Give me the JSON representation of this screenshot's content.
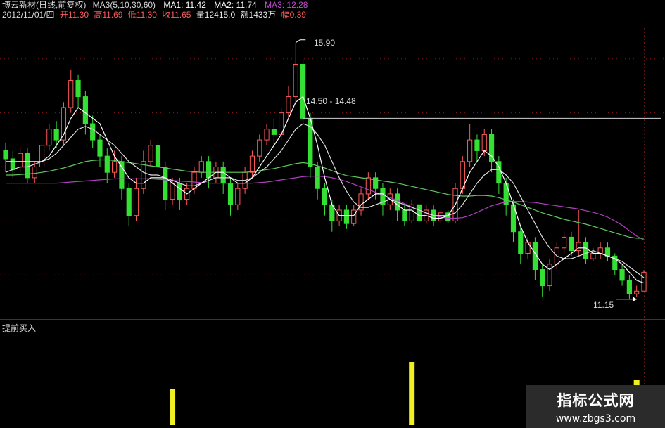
{
  "header": {
    "stock_name": "博云新材(日线,前复权)",
    "ma3_label": "MA3(5,10,30,60)",
    "ma1": "MA1: 11.42",
    "ma2": "MA2: 11.74",
    "ma3": "MA3: 12.28",
    "date": "2012/11/01/四",
    "open": "开11.30",
    "high": "高11.69",
    "low": "低11.30",
    "close": "收11.65",
    "volume": "量12415.0",
    "amount": "额1433万",
    "change": "幅0.39"
  },
  "annotations": {
    "high_price": "15.90",
    "range": "14.50 - 14.48",
    "low_price": "11.15"
  },
  "indicator": {
    "title": "提前买入"
  },
  "watermark": {
    "line1": "指标公式网",
    "line2": "www.zbgs3.com"
  },
  "colors": {
    "up": "#ff5a5a",
    "down": "#33e033",
    "ma_white": "#ffffff",
    "ma_green": "#5ec85e",
    "ma_purple": "#b040c0",
    "signal": "#f0f020",
    "divider": "#b02020"
  },
  "chart_data": [
    {
      "type": "candlestick",
      "title": "博云新材(日线,前复权)",
      "ylim": [
        10.9,
        16.3
      ],
      "annotations": {
        "high": 15.9,
        "range": [
          14.5,
          14.48
        ],
        "low": 11.15
      },
      "ohlc": [
        [
          13.9,
          13.75,
          14.05,
          13.5
        ],
        [
          13.75,
          13.55,
          13.9,
          13.4
        ],
        [
          13.6,
          13.85,
          13.95,
          13.5
        ],
        [
          13.85,
          13.4,
          13.95,
          13.3
        ],
        [
          13.4,
          13.6,
          13.7,
          13.3
        ],
        [
          13.6,
          14.0,
          14.1,
          13.55
        ],
        [
          14.0,
          14.3,
          14.4,
          13.9
        ],
        [
          14.3,
          14.1,
          14.45,
          13.95
        ],
        [
          14.1,
          14.7,
          14.8,
          14.0
        ],
        [
          14.7,
          15.2,
          15.4,
          14.6
        ],
        [
          15.2,
          14.9,
          15.3,
          14.7
        ],
        [
          14.9,
          14.4,
          15.0,
          14.2
        ],
        [
          14.4,
          14.1,
          14.55,
          13.95
        ],
        [
          14.1,
          13.8,
          14.2,
          13.6
        ],
        [
          13.8,
          13.5,
          13.95,
          13.3
        ],
        [
          13.5,
          13.7,
          13.9,
          13.4
        ],
        [
          13.7,
          13.2,
          13.8,
          13.0
        ],
        [
          13.2,
          12.7,
          13.3,
          12.5
        ],
        [
          12.7,
          13.2,
          13.4,
          12.6
        ],
        [
          13.2,
          13.7,
          13.9,
          13.1
        ],
        [
          13.7,
          14.0,
          14.1,
          13.6
        ],
        [
          14.0,
          13.6,
          14.1,
          13.4
        ],
        [
          13.6,
          13.0,
          13.7,
          12.8
        ],
        [
          13.0,
          13.3,
          13.4,
          12.9
        ],
        [
          13.3,
          13.0,
          13.4,
          12.8
        ],
        [
          13.0,
          13.2,
          13.3,
          12.9
        ],
        [
          13.2,
          13.5,
          13.6,
          13.1
        ],
        [
          13.5,
          13.7,
          13.8,
          13.4
        ],
        [
          13.7,
          13.4,
          13.8,
          13.2
        ],
        [
          13.4,
          13.6,
          13.7,
          13.3
        ],
        [
          13.6,
          13.3,
          13.7,
          13.1
        ],
        [
          13.3,
          12.9,
          13.4,
          12.7
        ],
        [
          12.9,
          13.2,
          13.3,
          12.8
        ],
        [
          13.2,
          13.5,
          13.6,
          13.1
        ],
        [
          13.5,
          13.8,
          13.9,
          13.4
        ],
        [
          13.8,
          14.1,
          14.2,
          13.7
        ],
        [
          14.1,
          14.3,
          14.4,
          14.0
        ],
        [
          14.3,
          14.2,
          14.5,
          14.0
        ],
        [
          14.2,
          14.6,
          14.7,
          14.1
        ],
        [
          14.6,
          14.9,
          15.1,
          14.5
        ],
        [
          14.9,
          15.5,
          15.9,
          14.8
        ],
        [
          15.5,
          14.5,
          15.6,
          14.4
        ],
        [
          14.5,
          13.6,
          14.6,
          13.4
        ],
        [
          13.6,
          13.2,
          13.7,
          13.0
        ],
        [
          13.2,
          12.9,
          13.3,
          12.7
        ],
        [
          12.9,
          12.6,
          13.0,
          12.4
        ],
        [
          12.6,
          12.8,
          12.9,
          12.5
        ],
        [
          12.8,
          12.55,
          12.9,
          12.45
        ],
        [
          12.55,
          12.8,
          12.9,
          12.5
        ],
        [
          12.8,
          13.1,
          13.2,
          12.7
        ],
        [
          13.1,
          13.4,
          13.5,
          13.0
        ],
        [
          13.4,
          13.2,
          13.5,
          13.0
        ],
        [
          13.2,
          12.9,
          13.3,
          12.7
        ],
        [
          12.9,
          13.1,
          13.2,
          12.8
        ],
        [
          13.1,
          12.8,
          13.2,
          12.6
        ],
        [
          12.8,
          12.6,
          12.9,
          12.5
        ],
        [
          12.6,
          12.9,
          13.0,
          12.55
        ],
        [
          12.9,
          12.6,
          13.0,
          12.5
        ],
        [
          12.6,
          12.8,
          12.9,
          12.55
        ],
        [
          12.8,
          12.6,
          12.9,
          12.5
        ],
        [
          12.6,
          12.75,
          12.8,
          12.55
        ],
        [
          12.75,
          12.6,
          12.8,
          12.55
        ],
        [
          12.6,
          13.2,
          13.3,
          12.55
        ],
        [
          13.2,
          13.7,
          13.8,
          13.1
        ],
        [
          13.7,
          14.1,
          14.4,
          13.6
        ],
        [
          14.1,
          13.9,
          14.2,
          13.7
        ],
        [
          13.9,
          14.2,
          14.3,
          13.8
        ],
        [
          14.2,
          13.7,
          14.3,
          13.5
        ],
        [
          13.7,
          13.3,
          13.8,
          13.1
        ],
        [
          13.3,
          12.9,
          13.4,
          12.7
        ],
        [
          12.9,
          12.4,
          13.0,
          12.2
        ],
        [
          12.4,
          12.0,
          12.5,
          11.8
        ],
        [
          12.0,
          12.2,
          12.3,
          11.9
        ],
        [
          12.2,
          11.7,
          12.3,
          11.5
        ],
        [
          11.7,
          11.4,
          11.8,
          11.2
        ],
        [
          11.4,
          11.8,
          11.9,
          11.3
        ],
        [
          11.8,
          12.1,
          12.2,
          11.7
        ],
        [
          12.1,
          12.3,
          12.4,
          12.0
        ],
        [
          12.3,
          12.05,
          12.4,
          11.95
        ],
        [
          12.05,
          12.2,
          12.8,
          11.95
        ],
        [
          12.2,
          11.9,
          12.3,
          11.8
        ],
        [
          11.9,
          12.0,
          12.1,
          11.85
        ],
        [
          12.0,
          12.1,
          12.2,
          11.9
        ],
        [
          12.1,
          11.95,
          12.2,
          11.85
        ],
        [
          11.95,
          11.7,
          12.0,
          11.6
        ],
        [
          11.7,
          11.5,
          11.8,
          11.4
        ],
        [
          11.5,
          11.25,
          11.6,
          11.15
        ],
        [
          11.25,
          11.3,
          11.4,
          11.2
        ],
        [
          11.3,
          11.65,
          11.69,
          11.3
        ]
      ],
      "ma_white": [
        13.7,
        13.7,
        13.7,
        13.7,
        13.7,
        13.7,
        13.8,
        14.0,
        14.2,
        14.5,
        14.7,
        14.6,
        14.5,
        14.4,
        14.1,
        13.8,
        13.6,
        13.4,
        13.3,
        13.3,
        13.4,
        13.4,
        13.4,
        13.3,
        13.2,
        13.1,
        13.2,
        13.3,
        13.4,
        13.5,
        13.5,
        13.4,
        13.3,
        13.3,
        13.4,
        13.6,
        13.8,
        14.0,
        14.2,
        14.5,
        14.8,
        14.9,
        14.5,
        14.0,
        13.4,
        12.9,
        12.7,
        12.7,
        12.7,
        12.9,
        13.0,
        13.1,
        13.1,
        13.0,
        12.9,
        12.8,
        12.8,
        12.7,
        12.7,
        12.65,
        12.65,
        12.7,
        12.9,
        13.2,
        13.5,
        13.7,
        13.9,
        13.8,
        13.6,
        13.3,
        12.9,
        12.5,
        12.2,
        12.0,
        11.8,
        11.7,
        11.8,
        11.9,
        12.0,
        12.1,
        12.1,
        12.0,
        12.0,
        11.95,
        11.9,
        11.8,
        11.65,
        11.5,
        11.45
      ],
      "ma_white2": [
        13.5,
        13.55,
        13.6,
        13.6,
        13.65,
        13.7,
        13.75,
        13.85,
        14.0,
        14.15,
        14.3,
        14.35,
        14.3,
        14.2,
        14.1,
        14.0,
        13.85,
        13.7,
        13.6,
        13.5,
        13.45,
        13.45,
        13.4,
        13.35,
        13.3,
        13.25,
        13.25,
        13.3,
        13.35,
        13.4,
        13.4,
        13.4,
        13.35,
        13.35,
        13.4,
        13.5,
        13.6,
        13.75,
        13.9,
        14.1,
        14.3,
        14.4,
        14.35,
        14.2,
        14.0,
        13.7,
        13.4,
        13.15,
        12.95,
        12.85,
        12.85,
        12.9,
        12.95,
        13.0,
        12.95,
        12.9,
        12.85,
        12.8,
        12.75,
        12.7,
        12.7,
        12.7,
        12.75,
        12.9,
        13.1,
        13.3,
        13.45,
        13.55,
        13.55,
        13.45,
        13.3,
        13.05,
        12.8,
        12.55,
        12.3,
        12.1,
        11.95,
        11.9,
        11.9,
        11.95,
        12.0,
        12.05,
        12.0,
        11.95,
        11.9,
        11.85,
        11.75,
        11.65,
        11.55
      ],
      "ma_green": [
        13.45,
        13.45,
        13.46,
        13.47,
        13.48,
        13.5,
        13.52,
        13.55,
        13.58,
        13.62,
        13.66,
        13.7,
        13.72,
        13.73,
        13.73,
        13.72,
        13.7,
        13.68,
        13.66,
        13.64,
        13.62,
        13.6,
        13.58,
        13.56,
        13.54,
        13.52,
        13.51,
        13.5,
        13.5,
        13.5,
        13.5,
        13.5,
        13.5,
        13.5,
        13.51,
        13.53,
        13.55,
        13.57,
        13.6,
        13.63,
        13.66,
        13.68,
        13.66,
        13.62,
        13.58,
        13.53,
        13.48,
        13.44,
        13.42,
        13.4,
        13.38,
        13.36,
        13.34,
        13.32,
        13.3,
        13.27,
        13.24,
        13.21,
        13.18,
        13.15,
        13.12,
        13.09,
        13.07,
        13.06,
        13.06,
        13.07,
        13.07,
        13.06,
        13.03,
        12.99,
        12.95,
        12.9,
        12.85,
        12.8,
        12.75,
        12.71,
        12.67,
        12.63,
        12.6,
        12.57,
        12.54,
        12.5,
        12.46,
        12.42,
        12.38,
        12.34,
        12.3,
        12.28,
        12.28
      ],
      "ma_purple": [
        13.3,
        13.3,
        13.3,
        13.3,
        13.3,
        13.3,
        13.3,
        13.3,
        13.31,
        13.32,
        13.33,
        13.34,
        13.35,
        13.36,
        13.37,
        13.38,
        13.38,
        13.38,
        13.38,
        13.38,
        13.38,
        13.37,
        13.36,
        13.35,
        13.34,
        13.33,
        13.32,
        13.31,
        13.3,
        13.3,
        13.3,
        13.3,
        13.3,
        13.3,
        13.3,
        13.31,
        13.32,
        13.34,
        13.36,
        13.38,
        13.4,
        13.42,
        13.43,
        13.43,
        13.42,
        13.4,
        13.37,
        13.33,
        13.28,
        13.23,
        13.18,
        13.13,
        13.08,
        13.03,
        12.98,
        12.92,
        12.86,
        12.8,
        12.74,
        12.7,
        12.67,
        12.65,
        12.65,
        12.66,
        12.7,
        12.76,
        12.82,
        12.88,
        12.92,
        12.95,
        12.96,
        12.96,
        12.95,
        12.94,
        12.92,
        12.9,
        12.88,
        12.86,
        12.84,
        12.82,
        12.79,
        12.76,
        12.72,
        12.67,
        12.6,
        12.52,
        12.42,
        12.32,
        12.25
      ],
      "signals": [
        23,
        56,
        87
      ]
    }
  ]
}
